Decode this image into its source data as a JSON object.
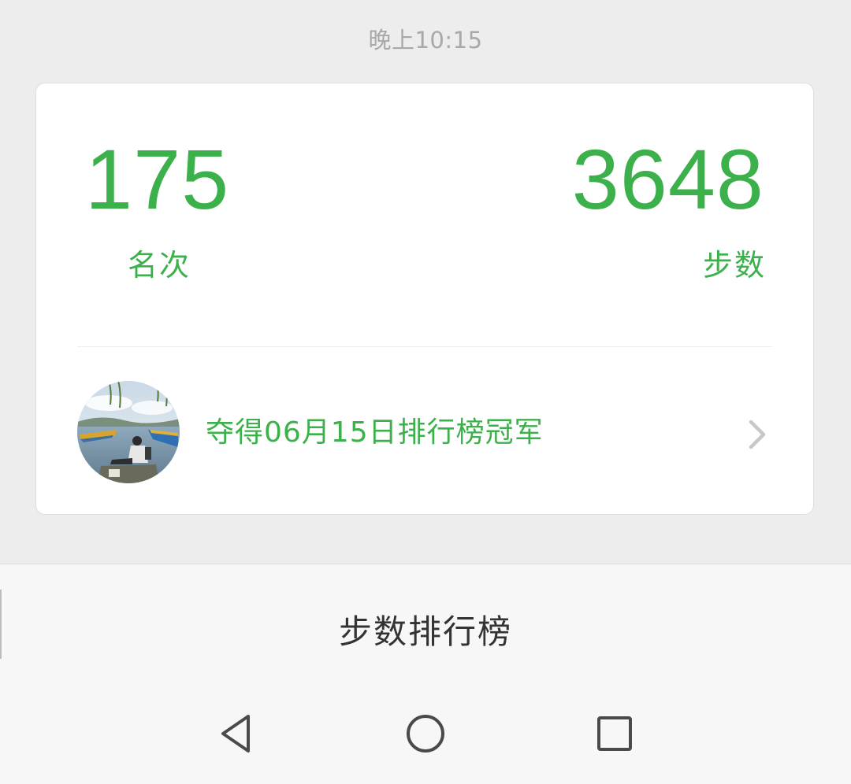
{
  "header": {
    "timestamp": "晚上10:15"
  },
  "ranking_card": {
    "rank_value": "175",
    "rank_label": "名次",
    "steps_value": "3648",
    "steps_label": "步数",
    "champion_text": "夺得06月15日排行榜冠军",
    "accent_color": "#3cb14b"
  },
  "bottom": {
    "leaderboard_label": "步数排行榜"
  },
  "nav": {
    "back_icon": "back-triangle-icon",
    "home_icon": "home-circle-icon",
    "recent_icon": "recent-apps-square-icon"
  }
}
